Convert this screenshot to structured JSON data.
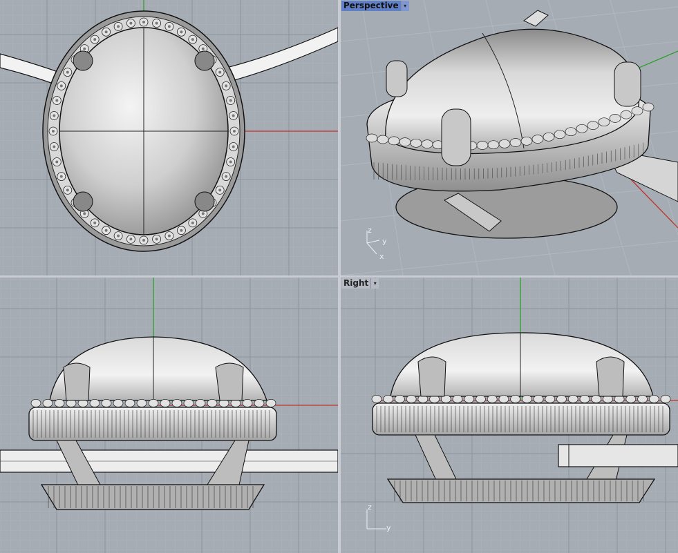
{
  "viewports": {
    "top": {
      "label": ""
    },
    "perspective": {
      "label": "Perspective",
      "active": true
    },
    "front": {
      "label": ""
    },
    "right": {
      "label": "Right"
    }
  },
  "axis_icons": {
    "perspective": {
      "z": "z",
      "y": "y",
      "x": "x"
    },
    "right": {
      "z": "z",
      "y": "y"
    }
  },
  "colors": {
    "viewport_bg": "#a6acb4",
    "grid_minor": "#b0b5bc",
    "grid_major": "#8e949c",
    "x_axis": "#c0312b",
    "y_axis": "#2da02d",
    "active_label": "#5f7fc6"
  },
  "icons": {
    "viewport_menu": "▾"
  }
}
